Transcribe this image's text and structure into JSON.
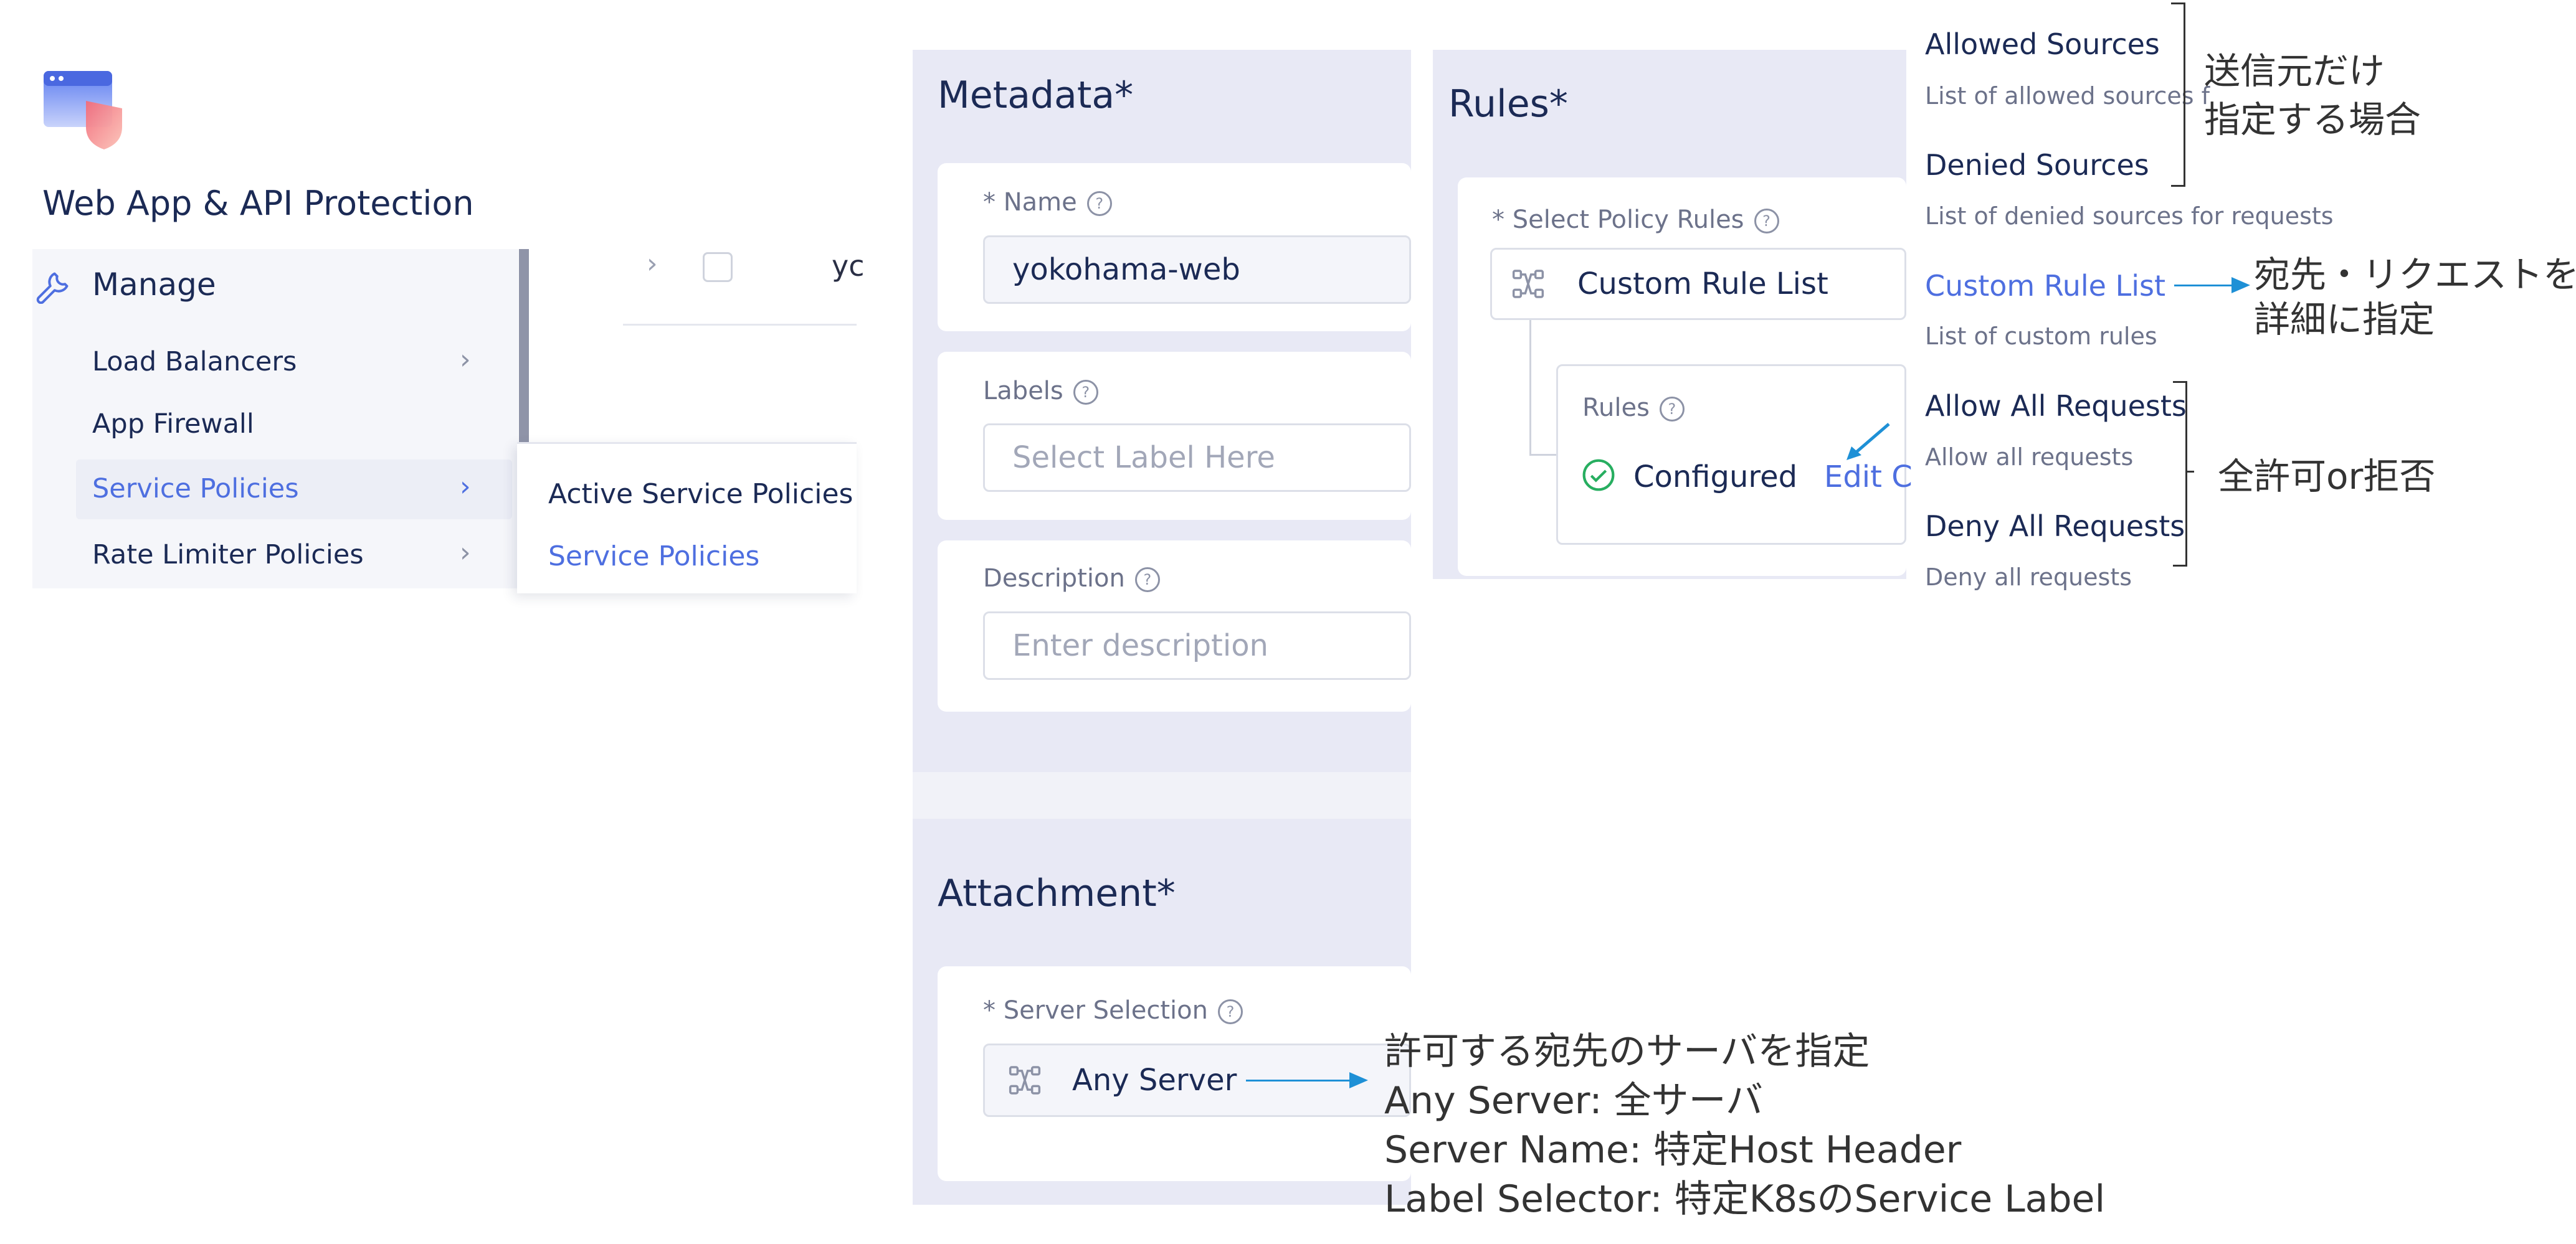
{
  "app": {
    "title": "Web App & API Protection"
  },
  "nav": {
    "section": "Manage",
    "items": [
      {
        "label": "Load Balancers",
        "has_chevron": true
      },
      {
        "label": "App Firewall",
        "has_chevron": false
      },
      {
        "label": "Service Policies",
        "has_chevron": true,
        "active": true
      },
      {
        "label": "Rate Limiter Policies",
        "has_chevron": true
      }
    ],
    "chevron": "›",
    "list_row_text": "yc"
  },
  "submenu": {
    "items": [
      "Active Service Policies",
      "Service Policies"
    ]
  },
  "metadata": {
    "title": "Metadata",
    "required_mark": "*",
    "name_label": "Name",
    "name_value": "yokohama-web",
    "labels_label": "Labels",
    "labels_placeholder": "Select Label Here",
    "description_label": "Description",
    "description_placeholder": "Enter description"
  },
  "attachment": {
    "title": "Attachment",
    "server_selection_label": "Server Selection",
    "server_selection_value": "Any Server"
  },
  "rules": {
    "title": "Rules",
    "select_label": "Select Policy Rules",
    "select_value": "Custom Rule List",
    "inner_label": "Rules",
    "status": "Configured",
    "edit_link": "Edit C"
  },
  "rule_options": [
    {
      "title": "Allowed Sources",
      "desc": "List of allowed sources f"
    },
    {
      "title": "Denied Sources",
      "desc": "List of denied sources for requests"
    },
    {
      "title": "Custom Rule List",
      "desc": "List of custom rules"
    },
    {
      "title": "Allow All Requests",
      "desc": "Allow all requests"
    },
    {
      "title": "Deny All Requests",
      "desc": "Deny all requests"
    }
  ],
  "annotations": {
    "sources_line1": "送信元だけ",
    "sources_line2": "指定する場合",
    "custom_line1": "宛先・リクエストを",
    "custom_line2": "詳細に指定",
    "allow_deny": "全許可or拒否",
    "server_line1": "許可する宛先のサーバを指定",
    "server_line2": "Any Server: 全サーバ",
    "server_line3": "Server Name: 特定Host Header",
    "server_line4": "Label Selector: 特定K8sのService Label"
  },
  "colors": {
    "accent": "#4e6fe0",
    "arrow": "#1e90d6",
    "panel": "#e8e9f5",
    "success": "#27ae60"
  },
  "icons": [
    "app-logo-icon",
    "wrench-icon",
    "help-icon",
    "chevron-right-icon",
    "rules-tree-icon",
    "check-circle-icon"
  ]
}
